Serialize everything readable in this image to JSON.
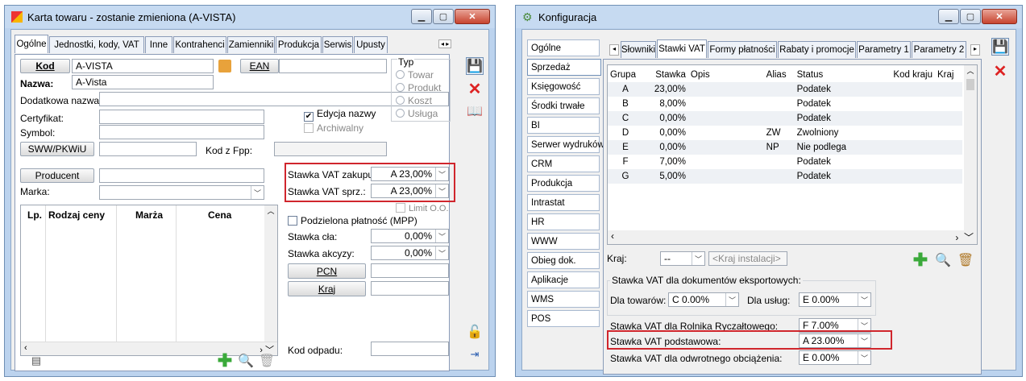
{
  "left": {
    "title": "Karta towaru - zostanie zmieniona (A-VISTA)",
    "tabs": [
      "Ogólne",
      "Jednostki, kody, VAT",
      "Inne",
      "Kontrahenci",
      "Zamienniki",
      "Produkcja",
      "Serwis",
      "Upusty"
    ],
    "kod_label": "Kod",
    "kod_value": "A-VISTA",
    "ean_label": "EAN",
    "ean_value": "",
    "nazwa_label": "Nazwa:",
    "nazwa_value": "A-Vista",
    "dodatkowa_label": "Dodatkowa nazwa:",
    "certyfikat_label": "Certyfikat:",
    "symbol_label": "Symbol:",
    "sww_label": "SWW/PKWiU",
    "kodfpp_label": "Kod z Fpp:",
    "typ_label": "Typ",
    "typ_options": [
      "Towar",
      "Produkt",
      "Koszt",
      "Usługa"
    ],
    "edycja_label": "Edycja nazwy",
    "archiwalny_label": "Archiwalny",
    "producent_label": "Producent",
    "marka_label": "Marka:",
    "stawka_zakupu_label": "Stawka VAT zakupu:",
    "stawka_zakupu_value": "A 23,00%",
    "stawka_sprz_label": "Stawka VAT sprz.:",
    "stawka_sprz_value": "A 23,00%",
    "limit_label": "Limit O.O.",
    "price_cols": [
      "Lp.",
      "Rodzaj ceny",
      "Marża",
      "Cena"
    ],
    "mpp_label": "Podzielona płatność (MPP)",
    "stawka_cla_label": "Stawka cła:",
    "stawka_cla_value": "0,00%",
    "stawka_akcyzy_label": "Stawka akcyzy:",
    "stawka_akcyzy_value": "0,00%",
    "pcn_label": "PCN",
    "kraj_label": "Kraj",
    "kod_odpadu_label": "Kod odpadu:"
  },
  "right": {
    "title": "Konfiguracja",
    "side_items": [
      "Ogólne",
      "Sprzedaż",
      "Księgowość",
      "Środki trwałe",
      "BI",
      "Serwer wydruków",
      "CRM",
      "Produkcja",
      "Intrastat",
      "HR",
      "WWW",
      "Obieg dok.",
      "Aplikacje",
      "WMS",
      "POS"
    ],
    "tabs": [
      "Słowniki",
      "Stawki VAT",
      "Formy płatności",
      "Rabaty i promocje",
      "Parametry 1",
      "Parametry 2"
    ],
    "cols": [
      "Grupa",
      "Stawka",
      "Opis",
      "Alias",
      "Status",
      "Kod kraju",
      "Kraj"
    ],
    "rows": [
      [
        "A",
        "23,00%",
        "",
        "",
        "Podatek"
      ],
      [
        "B",
        "8,00%",
        "",
        "",
        "Podatek"
      ],
      [
        "C",
        "0,00%",
        "",
        "",
        "Podatek"
      ],
      [
        "D",
        "0,00%",
        "",
        "ZW",
        "Zwolniony"
      ],
      [
        "E",
        "0,00%",
        "",
        "NP",
        "Nie podlega"
      ],
      [
        "F",
        "7,00%",
        "",
        "",
        "Podatek"
      ],
      [
        "G",
        "5,00%",
        "",
        "",
        "Podatek"
      ]
    ],
    "kraj_label": "Kraj:",
    "kraj_value": "--",
    "kraj_placeholder": "<Kraj instalacji>",
    "export_group": "Stawka VAT dla dokumentów eksportowych:",
    "dla_towarow_label": "Dla towarów:",
    "dla_towarow_value": "C 0.00%",
    "dla_uslug_label": "Dla usług:",
    "dla_uslug_value": "E 0.00%",
    "rolnika_label": "Stawka VAT dla Rolnika Ryczałtowego:",
    "rolnika_value": "F 7.00%",
    "podstawowa_label": "Stawka VAT podstawowa:",
    "podstawowa_value": "A 23.00%",
    "odwrotnego_label": "Stawka VAT dla odwrotnego obciążenia:",
    "odwrotnego_value": "E 0.00%"
  }
}
